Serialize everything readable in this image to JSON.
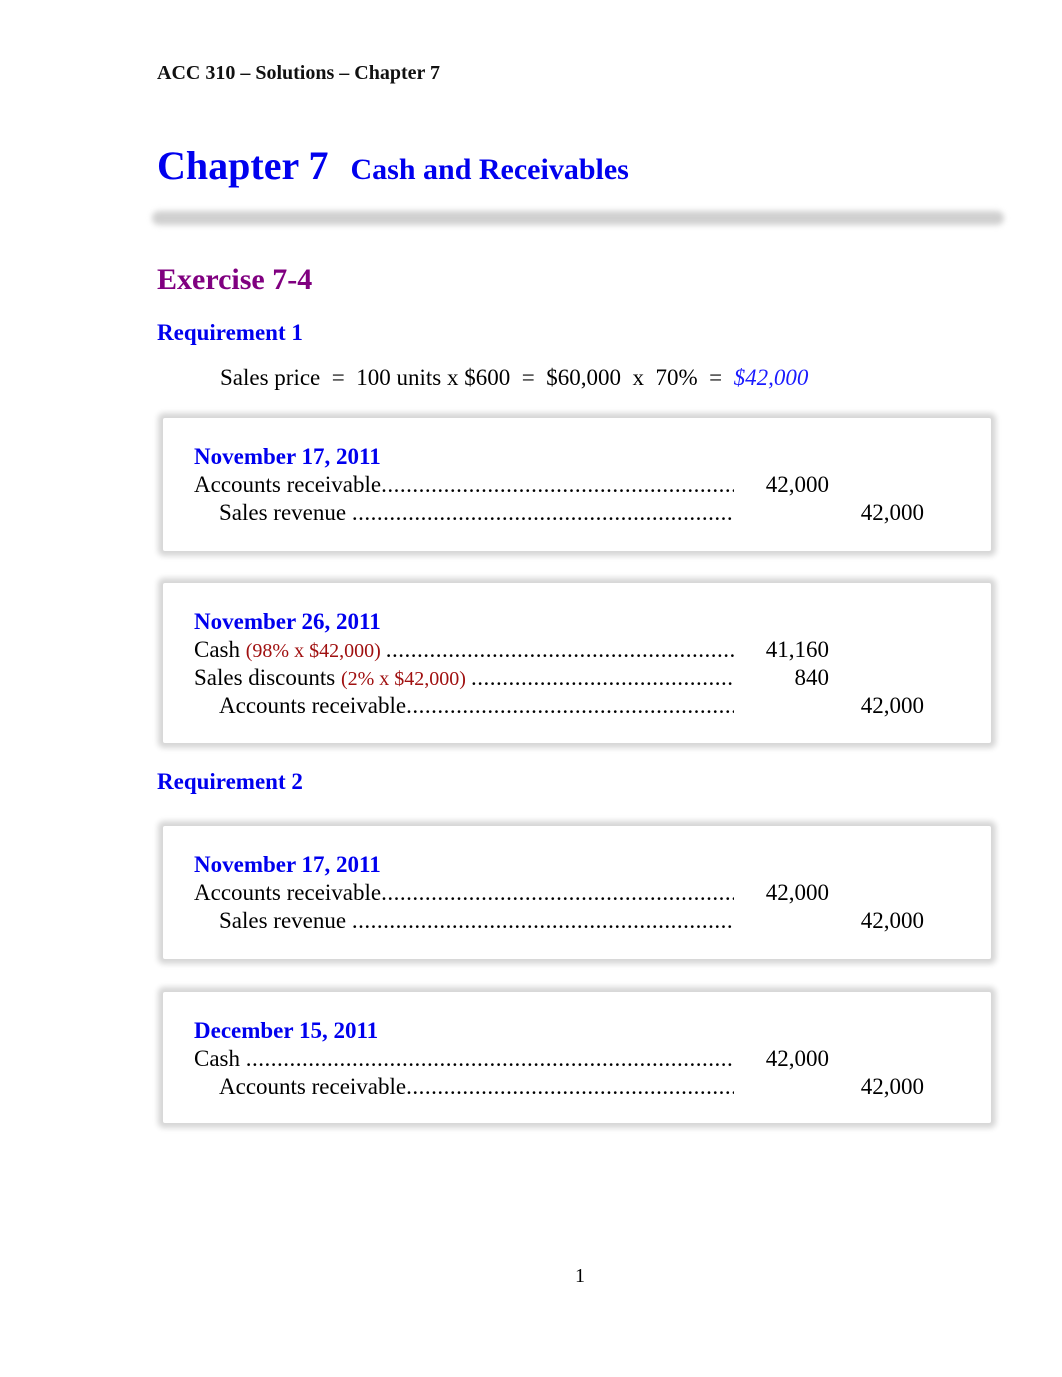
{
  "header": {
    "running_title": "ACC 310 – Solutions – Chapter 7"
  },
  "chapter": {
    "number_label": "Chapter 7",
    "title": "Cash and Receivables"
  },
  "exercise": {
    "title": "Exercise 7-4"
  },
  "requirement_1": {
    "title": "Requirement 1",
    "formula": {
      "label": "Sales price",
      "expression": "  =  100 units x $600  =  $60,000  x  70%  =  ",
      "result": "$42,000"
    },
    "entries": [
      {
        "date": "November 17, 2011",
        "lines": [
          {
            "account": "Accounts receivable",
            "note": "",
            "debit": "42,000",
            "credit": "",
            "indent": false
          },
          {
            "account": "Sales revenue ",
            "note": "",
            "debit": "",
            "credit": "42,000",
            "indent": true
          }
        ]
      },
      {
        "date": "November 26, 2011",
        "lines": [
          {
            "account": "Cash ",
            "note": "(98% x $42,000) ",
            "debit": "41,160",
            "credit": "",
            "indent": false
          },
          {
            "account": "Sales discounts ",
            "note": "(2% x $42,000) ",
            "debit": "840",
            "credit": "",
            "indent": false
          },
          {
            "account": "Accounts receivable",
            "note": "",
            "debit": "",
            "credit": "42,000",
            "indent": true
          }
        ]
      }
    ]
  },
  "requirement_2": {
    "title": "Requirement 2",
    "entries": [
      {
        "date": "November 17, 2011",
        "lines": [
          {
            "account": "Accounts receivable",
            "note": "",
            "debit": "42,000",
            "credit": "",
            "indent": false
          },
          {
            "account": "Sales revenue ",
            "note": "",
            "debit": "",
            "credit": "42,000",
            "indent": true
          }
        ]
      },
      {
        "date": "December 15, 2011",
        "lines": [
          {
            "account": "Cash ",
            "note": "",
            "debit": "42,000",
            "credit": "",
            "indent": false
          },
          {
            "account": "Accounts receivable",
            "note": "",
            "debit": "",
            "credit": "42,000",
            "indent": true
          }
        ]
      }
    ]
  },
  "footer": {
    "page_number": "1"
  }
}
